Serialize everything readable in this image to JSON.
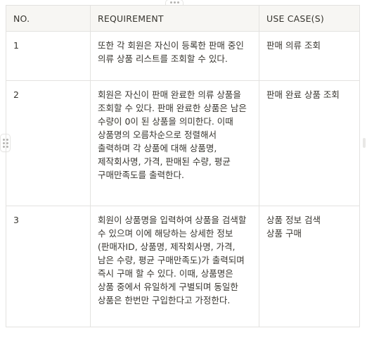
{
  "table": {
    "headers": [
      "NO.",
      "REQUIREMENT",
      "USE CASE(S)"
    ],
    "rows": [
      {
        "no": "1",
        "requirement": "또한 각 회원은 자신이 등록한 판매 중인 의류 상품 리스트를 조회할 수 있다.",
        "use_cases": [
          "판매 의류 조회"
        ]
      },
      {
        "no": "2",
        "requirement": "회원은 자신이 판매 완료한 의류 상품을 조회할 수 있다. 판매 완료한 상품은 남은 수량이 0이 된 상품을 의미한다. 이때 상품명의 오름차순으로 정렬해서 출력하며 각 상품에 대해 상품명, 제작회사명, 가격, 판매된 수량, 평균 구매만족도를 출력한다.",
        "use_cases": [
          "판매 완료 상품 조회"
        ]
      },
      {
        "no": "3",
        "requirement": "회원이 상품명을 입력하여 상품을 검색할 수 있으며 이에 해당하는 상세한 정보(판매자ID, 상품명, 제작회사명, 가격, 남은 수량, 평균 구매만족도)가 출력되며 즉시 구매 할 수 있다. 이때, 상품명은 상품 중에서 유일하게 구별되며 동일한 상품은 한번만 구입한다고 가정한다.",
        "use_cases": [
          "상품 정보 검색",
          "상품 구매"
        ]
      }
    ]
  }
}
